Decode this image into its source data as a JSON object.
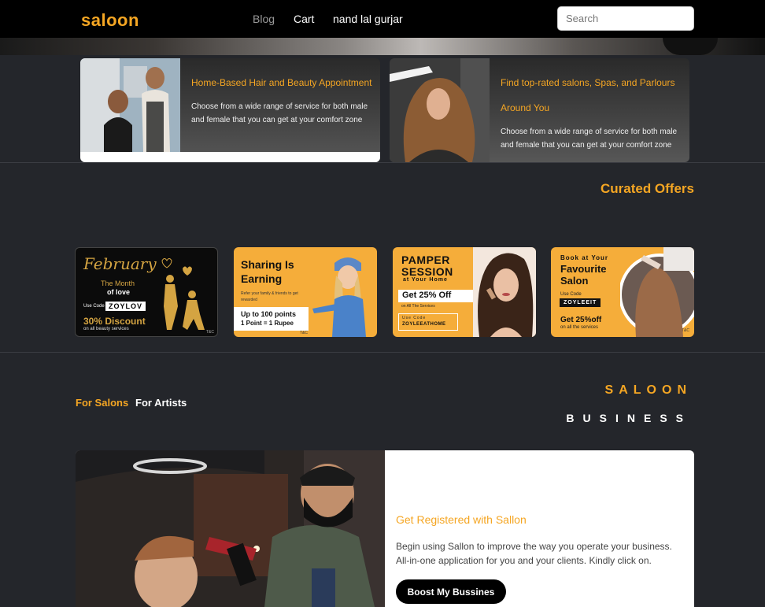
{
  "header": {
    "logo": "saloon",
    "nav": {
      "blog": "Blog",
      "cart": "Cart",
      "user": "nand lal gurjar"
    },
    "search": {
      "placeholder": "Search",
      "value": ""
    }
  },
  "features": [
    {
      "title": "Home-Based Hair and Beauty Appointment",
      "text": "Choose from a wide range of service for both male and female that you can get at your comfort zone"
    },
    {
      "title": "Find top-rated salons, Spas, and Parlours Around You",
      "text": "Choose from a wide range of service for both male and female that you can get at your comfort zone"
    }
  ],
  "offers": {
    "title": "Curated Offers",
    "items": [
      {
        "headline": "February",
        "sub1": "The Month",
        "sub2": "of love",
        "code_label": "Use Code",
        "code": "ZOYLOV",
        "discount": "30% Discount",
        "note": "on all beauty services",
        "tc": "T&C"
      },
      {
        "headline1": "Sharing Is",
        "headline2": "Earning",
        "desc": "Refer your family & friends to get rewarded",
        "reward1": "Up to 100 points",
        "reward2": "1 Point = 1 Rupee",
        "tc": "T&C"
      },
      {
        "headline1": "PAMPER",
        "headline2": "SESSION",
        "sub": "at Your Home",
        "deal": "Get 25% Off",
        "deal_note": "on All The Services",
        "code_label": "Use Code",
        "code": "ZOYLEEATHOME",
        "tc": "T&C"
      },
      {
        "headline1": "Book at Your",
        "headline2": "Favourite",
        "headline3": "Salon",
        "code_label": "Use Code",
        "code": "ZOYLEEIT",
        "deal": "Get 25%off",
        "deal_note": "on all the services",
        "tc": "T&C"
      }
    ]
  },
  "business": {
    "tabs": {
      "salons": "For Salons",
      "artists": "For Artists"
    },
    "heading1": "SALOON",
    "heading2": "BUSINESS",
    "card": {
      "title": "Get Registered with Sallon",
      "text": "Begin using Sallon to improve the way you operate your business. All-in-one application for you and your clients. Kindly click on.",
      "button": "Boost My Bussines"
    }
  }
}
